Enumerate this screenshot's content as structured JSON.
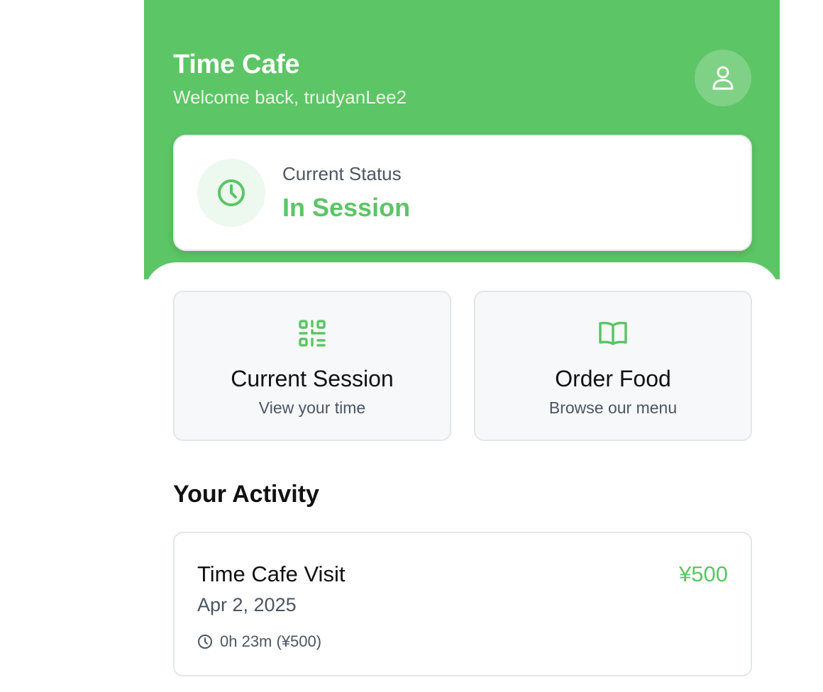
{
  "header": {
    "title": "Time Cafe",
    "welcome": "Welcome back, trudyanLee2",
    "avatar_icon": "user-icon"
  },
  "status": {
    "label": "Current Status",
    "value": "In Session",
    "icon": "clock-icon"
  },
  "actions": [
    {
      "title": "Current Session",
      "subtitle": "View your time",
      "icon": "qr-code-icon"
    },
    {
      "title": "Order Food",
      "subtitle": "Browse our menu",
      "icon": "book-open-icon"
    }
  ],
  "activity": {
    "section_title": "Your Activity",
    "items": [
      {
        "title": "Time Cafe Visit",
        "date": "Apr 2, 2025",
        "amount": "¥500",
        "duration": "0h 23m (¥500)",
        "icon": "clock-icon"
      }
    ]
  },
  "colors": {
    "brand": "#5cc565",
    "status_icon_bg": "#edf8ee",
    "muted_text": "#4b5563",
    "card_bg": "#f7f8fa"
  }
}
